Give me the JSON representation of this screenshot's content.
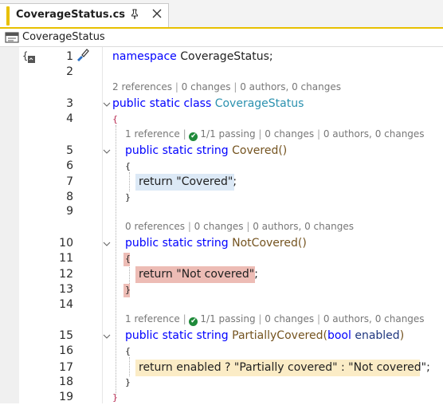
{
  "tab": {
    "title": "CoverageStatus.cs"
  },
  "navbar": {
    "class_name": "CoverageStatus"
  },
  "lines": {
    "l1": "1",
    "l2": "2",
    "l3": "3",
    "l4": "4",
    "l5": "5",
    "l6": "6",
    "l7": "7",
    "l8": "8",
    "l9": "9",
    "l10": "10",
    "l11": "11",
    "l12": "12",
    "l13": "13",
    "l14": "14",
    "l15": "15",
    "l16": "16",
    "l17": "17",
    "l18": "18",
    "l19": "19"
  },
  "code": {
    "kw_namespace": "namespace",
    "ns_name": "CoverageStatus;",
    "kw_public": "public",
    "kw_static": "static",
    "kw_class": "class",
    "class_name": "CoverageStatus",
    "kw_string": "string",
    "open_brace": "{",
    "close_brace": "}",
    "m_covered": "Covered",
    "m_notcovered": "NotCovered",
    "m_partial": "PartiallyCovered",
    "empty_parens": "()",
    "open_paren": "(",
    "close_paren": ")",
    "kw_bool": "bool",
    "param": "enabled",
    "ret_covered": "return \"Covered\";",
    "ret_notcovered": "return \"Not covered\";",
    "ret_partial": "return enabled ? \"Partially covered\" : \"Not covered\";"
  },
  "lens": {
    "class": {
      "refs": "2 references",
      "changes": "0 changes",
      "authors": "0 authors, 0 changes"
    },
    "covered": {
      "refs": "1 reference",
      "tests": "1/1 passing",
      "changes": "0 changes",
      "authors": "0 authors, 0 changes"
    },
    "notcovered": {
      "refs": "0 references",
      "changes": "0 changes",
      "authors": "0 authors, 0 changes"
    },
    "partial": {
      "refs": "1 reference",
      "tests": "1/1 passing",
      "changes": "0 changes",
      "authors": "0 authors, 0 changes"
    },
    "separator": " | "
  },
  "colors": {
    "covered": "#dce9f6",
    "not_covered": "#edbcb5",
    "partially_covered": "#fbecc6",
    "tab_accent": "#e8c000",
    "passing": "#1f8a3a"
  },
  "icons": [
    "pin-icon",
    "close-icon",
    "class-icon",
    "namespace-icon",
    "edit-icon",
    "check-icon",
    "collapse-icon"
  ]
}
